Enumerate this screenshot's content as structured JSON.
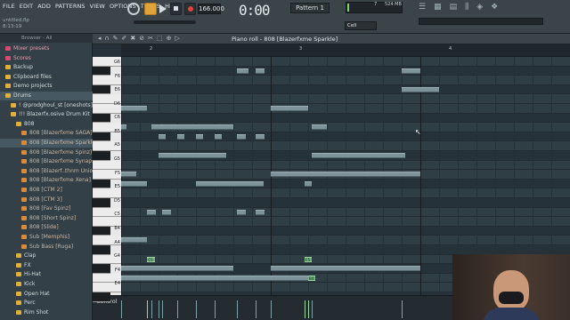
{
  "menu": [
    "FILE",
    "EDIT",
    "ADD",
    "PATTERNS",
    "VIEW",
    "OPTIONS",
    "TOOLS",
    "HELP"
  ],
  "song": {
    "file": "untitled.flp",
    "position": "8:13:19"
  },
  "transport": {
    "tempo": "166.000",
    "time": "0:00",
    "time_sub": "00",
    "pattern": "Pattern 1",
    "cpu_num": "7",
    "memory": "524 MB"
  },
  "snap": "Cell",
  "browser": {
    "header": "Browser - All",
    "items": [
      {
        "label": "Mixer presets",
        "icon": "folder-icon",
        "color": "#d84a70",
        "indent": 0
      },
      {
        "label": "Scores",
        "icon": "folder-icon",
        "color": "#d84a70",
        "indent": 0
      },
      {
        "label": "Backup",
        "icon": "folder-icon",
        "color": "#e0b03a",
        "indent": 0
      },
      {
        "label": "Clipboard files",
        "icon": "folder-icon",
        "color": "#e0b03a",
        "indent": 0
      },
      {
        "label": "Demo projects",
        "icon": "folder-icon",
        "color": "#e0b03a",
        "indent": 0
      },
      {
        "label": "Drums",
        "icon": "folder-open-icon",
        "color": "#e0b03a",
        "indent": 0,
        "selected": true
      },
      {
        "label": "! @prodghoul_st [oneshots]",
        "icon": "folder-icon",
        "color": "#e0b03a",
        "indent": 1
      },
      {
        "label": "!!! Blazerfx.osive Drum Kit",
        "icon": "folder-open-icon",
        "color": "#e0b03a",
        "indent": 1
      },
      {
        "label": "808",
        "icon": "folder-open-icon",
        "color": "#e0b03a",
        "indent": 2
      },
      {
        "label": "808 [Blazerfxme SAGA]",
        "icon": "audio-file-icon",
        "color": "#d98b3a",
        "indent": 3
      },
      {
        "label": "808 [Blazerfxme Sparkle]",
        "icon": "audio-file-icon",
        "color": "#d98b3a",
        "indent": 3,
        "selected": true
      },
      {
        "label": "808 [Blazerfxme Spinz]",
        "icon": "audio-file-icon",
        "color": "#d98b3a",
        "indent": 3
      },
      {
        "label": "808 [Blazerfxme Synapsis]",
        "icon": "audio-file-icon",
        "color": "#d98b3a",
        "indent": 3
      },
      {
        "label": "808 [Blazerf..thnm Union]",
        "icon": "audio-file-icon",
        "color": "#d98b3a",
        "indent": 3
      },
      {
        "label": "808 [Blazerfxme Xena]",
        "icon": "audio-file-icon",
        "color": "#d98b3a",
        "indent": 3
      },
      {
        "label": "808 [CTM 2]",
        "icon": "audio-file-icon",
        "color": "#d98b3a",
        "indent": 3
      },
      {
        "label": "808 [CTM 3]",
        "icon": "audio-file-icon",
        "color": "#d98b3a",
        "indent": 3
      },
      {
        "label": "808 [Fav Spinz]",
        "icon": "audio-file-icon",
        "color": "#d98b3a",
        "indent": 3
      },
      {
        "label": "808 [Short Spinz]",
        "icon": "audio-file-icon",
        "color": "#d98b3a",
        "indent": 3
      },
      {
        "label": "808 [Slide]",
        "icon": "audio-file-icon",
        "color": "#d98b3a",
        "indent": 3
      },
      {
        "label": "Sub [Memphis]",
        "icon": "audio-file-icon",
        "color": "#d98b3a",
        "indent": 3
      },
      {
        "label": "Sub Bass [Ruga]",
        "icon": "audio-file-icon",
        "color": "#d98b3a",
        "indent": 3
      },
      {
        "label": "Clap",
        "icon": "folder-icon",
        "color": "#e0b03a",
        "indent": 2
      },
      {
        "label": "FX",
        "icon": "folder-icon",
        "color": "#e0b03a",
        "indent": 2
      },
      {
        "label": "Hi-Hat",
        "icon": "folder-icon",
        "color": "#e0b03a",
        "indent": 2
      },
      {
        "label": "Kick",
        "icon": "folder-icon",
        "color": "#e0b03a",
        "indent": 2
      },
      {
        "label": "Open Hat",
        "icon": "folder-icon",
        "color": "#e0b03a",
        "indent": 2
      },
      {
        "label": "Perc",
        "icon": "folder-icon",
        "color": "#e0b03a",
        "indent": 2
      },
      {
        "label": "Rim Shot",
        "icon": "folder-icon",
        "color": "#e0b03a",
        "indent": 2
      }
    ]
  },
  "piano_roll": {
    "title": "Piano roll - 808 [Blazerfxme Sparkle]",
    "bar_labels": [
      "2",
      "3",
      "4"
    ],
    "key_labels": [
      "G6",
      "F6",
      "E6",
      "D6",
      "C6",
      "B5",
      "A5",
      "G5",
      "F5",
      "E5",
      "D5",
      "C5",
      "B4",
      "A4",
      "G4",
      "F4",
      "E4",
      "D4"
    ],
    "notes": [
      {
        "row": 1,
        "start": 1.55,
        "len": 0.15
      },
      {
        "row": 1,
        "start": 1.8,
        "len": 0.12
      },
      {
        "row": 1,
        "start": 3.75,
        "len": 0.25
      },
      {
        "row": 3,
        "start": 3.75,
        "len": 0.5
      },
      {
        "row": 5,
        "start": 0,
        "len": 0.35
      },
      {
        "row": 5,
        "start": 2,
        "len": 0.5
      },
      {
        "row": 7,
        "start": 0,
        "len": 0.05
      },
      {
        "row": 7,
        "start": 0.4,
        "len": 1.1
      },
      {
        "row": 7,
        "start": 2.55,
        "len": 0.2
      },
      {
        "row": 8,
        "start": 0.5,
        "len": 0.1
      },
      {
        "row": 8,
        "start": 0.75,
        "len": 0.1
      },
      {
        "row": 8,
        "start": 1.0,
        "len": 0.1
      },
      {
        "row": 8,
        "start": 1.25,
        "len": 0.1
      },
      {
        "row": 8,
        "start": 1.55,
        "len": 0.12
      },
      {
        "row": 8,
        "start": 1.8,
        "len": 0.12
      },
      {
        "row": 10,
        "start": 0.5,
        "len": 0.9
      },
      {
        "row": 10,
        "start": 2.55,
        "len": 1.25
      },
      {
        "row": 12,
        "start": 0,
        "len": 0.2
      },
      {
        "row": 12,
        "start": 2,
        "len": 2
      },
      {
        "row": 13,
        "start": 0,
        "len": 0.35
      },
      {
        "row": 13,
        "start": 1,
        "len": 0.9
      },
      {
        "row": 13,
        "start": 2.45,
        "len": 0.1
      },
      {
        "row": 16,
        "start": 0.35,
        "len": 0.12
      },
      {
        "row": 16,
        "start": 0.55,
        "len": 0.12
      },
      {
        "row": 16,
        "start": 1.55,
        "len": 0.12
      },
      {
        "row": 16,
        "start": 1.8,
        "len": 0.12
      },
      {
        "row": 19,
        "start": 0,
        "len": 0.35
      },
      {
        "row": 21,
        "start": 0.35,
        "len": 0.1,
        "selected": true,
        "label": "C5"
      },
      {
        "row": 21,
        "start": 2.45,
        "len": 0.1,
        "selected": true,
        "label": "C5"
      },
      {
        "row": 22,
        "start": 0,
        "len": 1.5
      },
      {
        "row": 22,
        "start": 2,
        "len": 2
      },
      {
        "row": 23,
        "start": 2.5,
        "len": 0.1,
        "selected": true,
        "label": "B4"
      },
      {
        "row": 23,
        "start": 0,
        "len": 2
      },
      {
        "row": 23,
        "start": 2,
        "len": 0.5
      }
    ]
  },
  "control": {
    "label": "Control"
  }
}
